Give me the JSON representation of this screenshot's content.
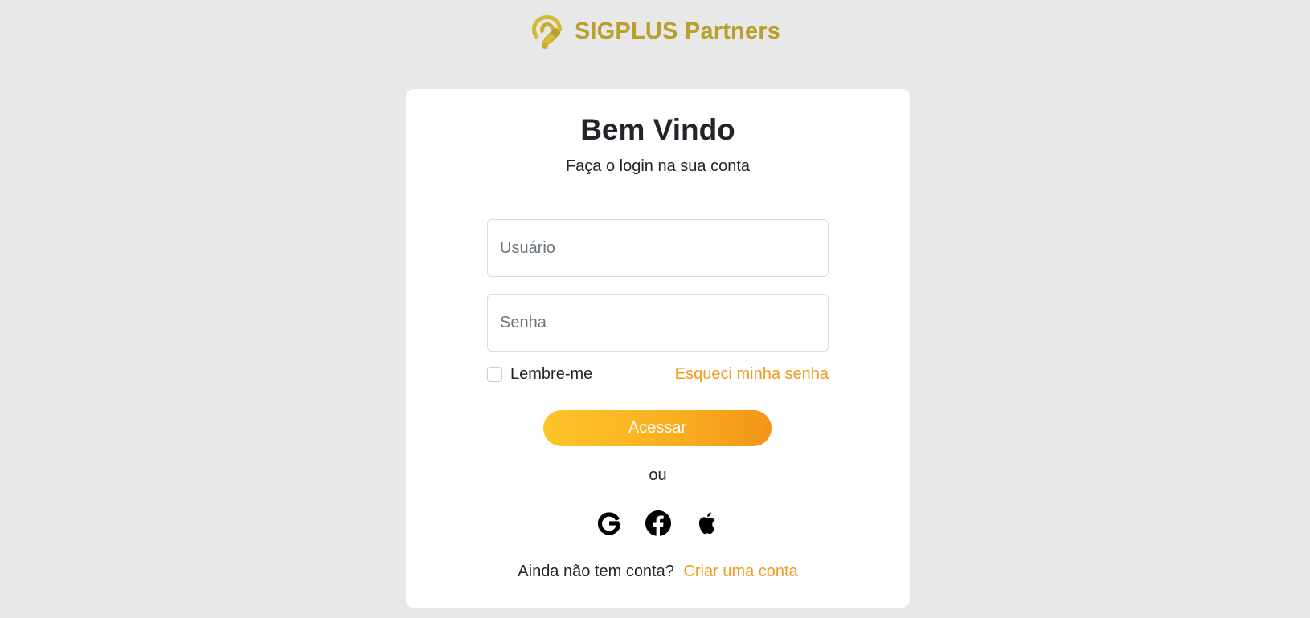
{
  "brand": {
    "name": "SIGPLUS Partners",
    "logo_icon": "pin-handshake-logo-icon",
    "color": "#b99f2c"
  },
  "login": {
    "title": "Bem Vindo",
    "subtitle": "Faça o login na sua conta",
    "username": {
      "placeholder": "Usuário",
      "value": ""
    },
    "password": {
      "placeholder": "Senha",
      "value": ""
    },
    "remember": {
      "label": "Lembre-me",
      "checked": false
    },
    "forgot_label": "Esqueci minha senha",
    "submit_label": "Acessar",
    "divider": "ou",
    "social": [
      {
        "name": "google",
        "icon": "google-icon"
      },
      {
        "name": "facebook",
        "icon": "facebook-icon"
      },
      {
        "name": "apple",
        "icon": "apple-icon"
      }
    ],
    "signup_prompt": "Ainda não tem conta?",
    "signup_link": "Criar uma conta"
  },
  "colors": {
    "accent": "#f39a1d",
    "button_gradient_start": "#fec42a",
    "button_gradient_end": "#f39518",
    "background": "#e8e8e8",
    "card": "#ffffff"
  }
}
